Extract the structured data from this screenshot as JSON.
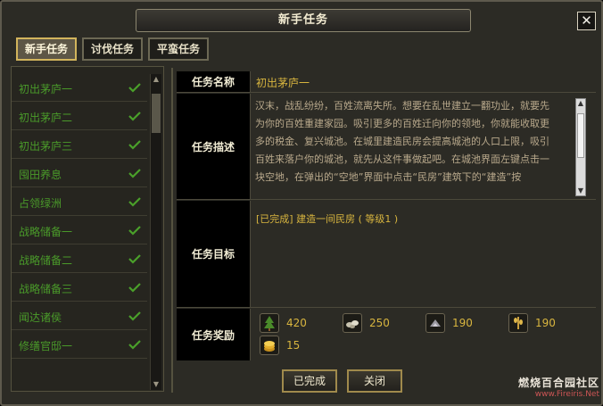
{
  "window": {
    "title": "新手任务",
    "close_label": "✕"
  },
  "tabs": [
    {
      "label": "新手任务",
      "active": true
    },
    {
      "label": "讨伐任务",
      "active": false
    },
    {
      "label": "平蛮任务",
      "active": false
    }
  ],
  "quest_list": [
    {
      "label": "初出茅庐一",
      "completed": true
    },
    {
      "label": "初出茅庐二",
      "completed": true
    },
    {
      "label": "初出茅庐三",
      "completed": true
    },
    {
      "label": "囤田养息",
      "completed": true
    },
    {
      "label": "占领绿洲",
      "completed": true
    },
    {
      "label": "战略储备一",
      "completed": true
    },
    {
      "label": "战略储备二",
      "completed": true
    },
    {
      "label": "战略储备三",
      "completed": true
    },
    {
      "label": "闻达诸侯",
      "completed": true
    },
    {
      "label": "修缮官邸一",
      "completed": true
    }
  ],
  "detail": {
    "name_header": "任务名称",
    "name_value": "初出茅庐一",
    "desc_header": "任务描述",
    "desc_lines": [
      "汉末，战乱纷纷，百姓流离失所。想要在乱世建立一翻功业，就要先",
      "为你的百姓重建家园。吸引更多的百姓迁向你的领地，你就能收取更",
      "多的税金、复兴城池。在城里建造民房会提高城池的人口上限，吸引",
      "百姓来落户你的城池，就先从这件事做起吧。在城池界面左键点击一",
      "块空地，在弹出的“空地”界面中点击“民房”建筑下的“建造”按"
    ],
    "goal_header": "任务目标",
    "goal_text": "[已完成] 建造一间民房 ( 等级1 )",
    "reward_header": "任务奖励",
    "rewards": [
      {
        "icon": "wood-icon",
        "value": "420"
      },
      {
        "icon": "stone-icon",
        "value": "250"
      },
      {
        "icon": "iron-icon",
        "value": "190"
      },
      {
        "icon": "grain-icon",
        "value": "190"
      },
      {
        "icon": "gold-coin-icon",
        "value": "15"
      }
    ]
  },
  "buttons": {
    "complete_label": "已完成",
    "close_label": "关闭"
  },
  "watermark": {
    "line1": "燃烧百合园社区",
    "line2": "www.Fireiris.Net"
  },
  "colors": {
    "accent_gold": "#d8b53f",
    "completed_green": "#4a9a2a"
  }
}
